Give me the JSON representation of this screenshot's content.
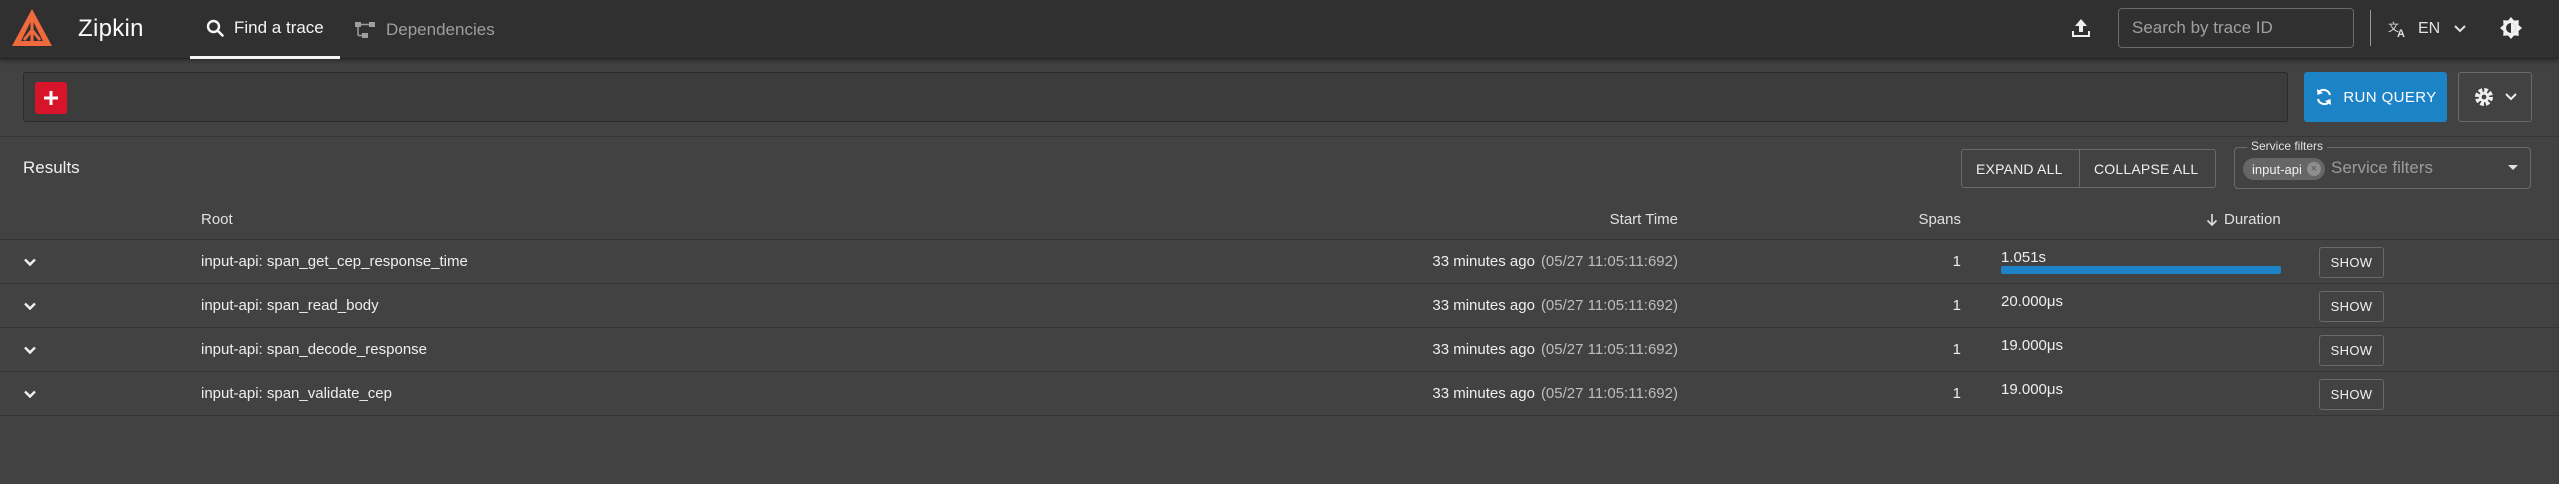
{
  "header": {
    "brand": "Zipkin",
    "tabs": [
      {
        "label": "Find a trace",
        "active": true,
        "icon": "search-icon"
      },
      {
        "label": "Dependencies",
        "active": false,
        "icon": "dependencies-icon"
      }
    ],
    "trace_search_placeholder": "Search by trace ID",
    "language": "EN"
  },
  "query": {
    "run_label": "RUN QUERY"
  },
  "results": {
    "title": "Results",
    "expand_all": "EXPAND ALL",
    "collapse_all": "COLLAPSE ALL",
    "service_filters": {
      "legend": "Service filters",
      "placeholder": "Service filters",
      "chips": [
        "input-api"
      ]
    },
    "columns": {
      "root": "Root",
      "start_time": "Start Time",
      "spans": "Spans",
      "duration": "Duration"
    },
    "rows": [
      {
        "root": "input-api: span_get_cep_response_time",
        "relative": "33 minutes ago",
        "absolute": "(05/27 11:05:11:692)",
        "spans": "1",
        "duration": "1.051s",
        "duration_fraction": 1.0,
        "show": "SHOW"
      },
      {
        "root": "input-api: span_read_body",
        "relative": "33 minutes ago",
        "absolute": "(05/27 11:05:11:692)",
        "spans": "1",
        "duration": "20.000μs",
        "duration_fraction": 0.0,
        "show": "SHOW"
      },
      {
        "root": "input-api: span_decode_response",
        "relative": "33 minutes ago",
        "absolute": "(05/27 11:05:11:692)",
        "spans": "1",
        "duration": "19.000μs",
        "duration_fraction": 0.0,
        "show": "SHOW"
      },
      {
        "root": "input-api: span_validate_cep",
        "relative": "33 minutes ago",
        "absolute": "(05/27 11:05:11:692)",
        "spans": "1",
        "duration": "19.000μs",
        "duration_fraction": 0.0,
        "show": "SHOW"
      }
    ]
  },
  "colors": {
    "accent_blue": "#1d83c7",
    "add_red": "#d7142a",
    "logo_orange": "#f06a3c"
  }
}
